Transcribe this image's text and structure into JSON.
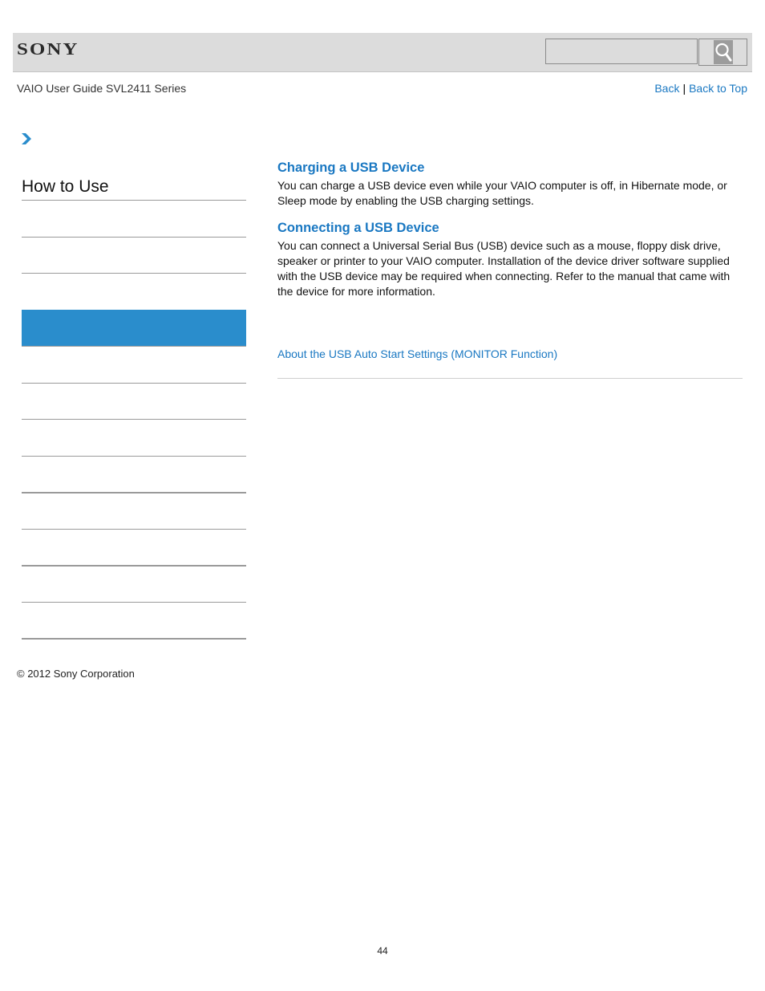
{
  "header": {
    "logo": "SONY",
    "search": {
      "value": "",
      "placeholder": ""
    }
  },
  "subheader": {
    "guide_title": "VAIO User Guide SVL2411 Series",
    "back_label": "Back",
    "separator": "|",
    "back_to_top_label": "Back to Top"
  },
  "sidebar": {
    "title": "How to Use",
    "active_index": 3,
    "item_count": 12
  },
  "content": {
    "sections": [
      {
        "title": "Charging a USB Device",
        "body": "You can charge a USB device even while your VAIO computer is off, in Hibernate mode, or Sleep mode by enabling the USB charging settings."
      },
      {
        "title": "Connecting a USB Device",
        "body": "You can connect a Universal Serial Bus (USB) device such as a mouse, floppy disk drive, speaker or printer to your VAIO computer. Installation of the device driver software supplied with the USB device may be required when connecting. Refer to the manual that came with the device for more information."
      }
    ],
    "related_link": "About the USB Auto Start Settings (MONITOR Function)"
  },
  "footer": {
    "copyright": "© 2012 Sony Corporation",
    "page_number": "44"
  },
  "colors": {
    "accent": "#1a78c2",
    "active_item": "#2a8dcc",
    "header_bg": "#dcdcdc"
  }
}
